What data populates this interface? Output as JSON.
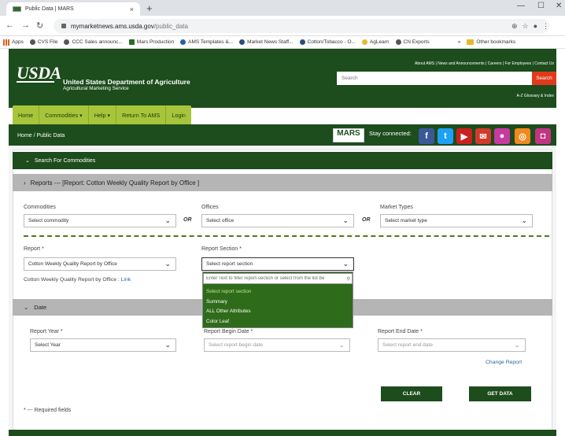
{
  "browser": {
    "tab_title": "Public Data | MARS",
    "tab_close": "×",
    "new_tab": "+",
    "url_host": "mymarketnews.ams.usda.gov",
    "url_path": "/public_data",
    "bookmarks": [
      "Apps",
      "CVS File",
      "CCC Sales announc...",
      "Mars Production",
      "AMS Templates &...",
      "Market News Staff...",
      "Cotton/Tobacco - O...",
      "AgLearn",
      "CN Exports",
      "Other bookmarks"
    ],
    "bookmarks_more": "»"
  },
  "header": {
    "logo": "USDA",
    "org_name": "United States Department of Agriculture",
    "sub_name": "Agricultural Marketing Service",
    "top_links": "About AMS | News and Announcements | Careers | For Employees | Contact Us",
    "search_placeholder": "Search",
    "search_button": "Search",
    "az_glossary": "A-Z Glossary & Index"
  },
  "menu": [
    "Home",
    "Commodities ▾",
    "Help ▾",
    "Return To AMS",
    "Login"
  ],
  "breadcrumb": "Home  /  Public Data",
  "mars_logo": "MARS",
  "stay_connected": "Stay connected:",
  "social": [
    {
      "name": "facebook-icon",
      "glyph": "f",
      "color": "#3b5998"
    },
    {
      "name": "twitter-icon",
      "glyph": "t",
      "color": "#1da1f2"
    },
    {
      "name": "youtube-icon",
      "glyph": "▶",
      "color": "#cc2020"
    },
    {
      "name": "email-icon",
      "glyph": "✉",
      "color": "#d23b2b"
    },
    {
      "name": "flickr-icon",
      "glyph": "●",
      "color": "#c83aa0"
    },
    {
      "name": "rss-icon",
      "glyph": "◎",
      "color": "#f08a20"
    },
    {
      "name": "instagram-icon",
      "glyph": "◘",
      "color": "#c13584"
    }
  ],
  "search_section": "Search For Commodities",
  "reports_header": "Reports --- [Report: Cotton Weekly Quality Report by Office ]",
  "form": {
    "commodities_label": "Commodities",
    "commodities_value": "Select commodity",
    "offices_label": "Offices",
    "offices_value": "Select office",
    "market_types_label": "Market Types",
    "market_types_value": "Select market type",
    "or": "OR",
    "report_label": "Report *",
    "report_value": "Cotton Weekly Quality Report by Office",
    "report_section_label": "Report Section *",
    "report_section_value": "Select report section",
    "report_link_prefix": "Cotton Weekly Quality Report by Office : ",
    "report_link": "Link"
  },
  "dropdown": {
    "filter_placeholder": "Enter Text to filter report-section or select from the list be",
    "options": [
      "Select report section",
      "Summary",
      "ALL Other Attributes",
      "Color Leaf"
    ]
  },
  "date_section": "Date",
  "dates": {
    "year_label": "Report Year *",
    "year_value": "Select Year",
    "begin_label": "Report Begin Date *",
    "begin_value": "Select report begin date",
    "end_label": "Report End Date *",
    "end_value": "Select report end date",
    "change_report": "Change Report"
  },
  "buttons": {
    "clear": "CLEAR",
    "get_data": "GET DATA"
  },
  "required_note": "* --- Required fields",
  "colors": {
    "usda_green": "#1d4c1d",
    "menu_green": "#a7c53b",
    "search_red": "#e03a1a"
  }
}
